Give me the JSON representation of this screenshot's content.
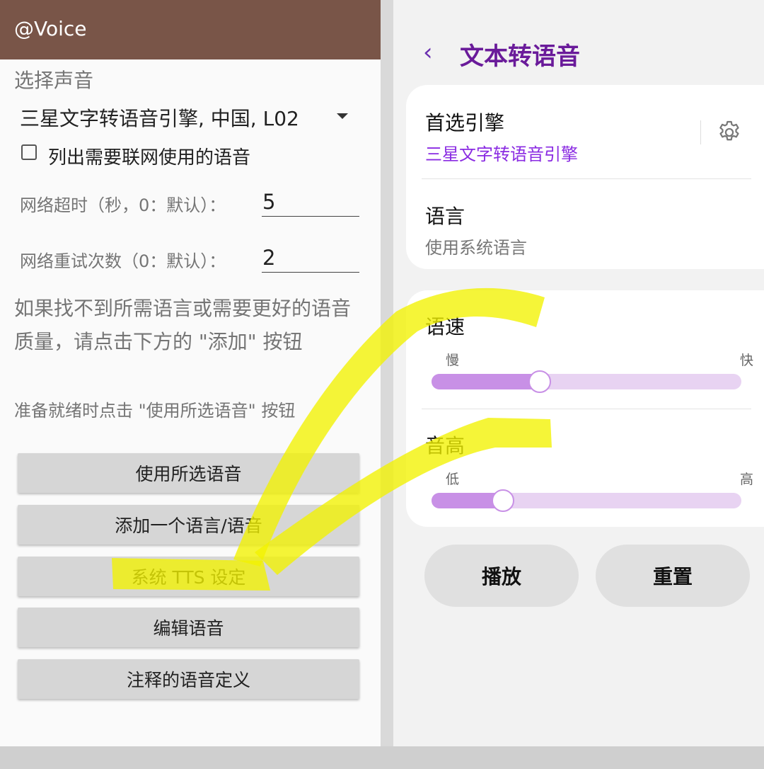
{
  "left_app": {
    "title": "@Voice",
    "select_voice_label": "选择声音",
    "voice_dropdown_value": "三星文字转语音引擎, 中国, L02",
    "network_voices_checkbox_label": "列出需要联网使用的语音",
    "network_timeout": {
      "label": "网络超时（秒，0：默认）：",
      "value": "5"
    },
    "network_retries": {
      "label": "网络重试次数（0：默认）：",
      "value": "2"
    },
    "help_text": "如果找不到所需语言或需要更好的语音质量，请点击下方的 \"添加\" 按钮",
    "ready_text": "准备就绪时点击 \"使用所选语音\" 按钮",
    "buttons": [
      "使用所选语音",
      "添加一个语言/语音",
      "系统 TTS 设定",
      "编辑语音",
      "注释的语音定义"
    ]
  },
  "right_settings": {
    "back_icon": "chevron-left-icon",
    "title": "文本转语音",
    "preferred_engine": {
      "label": "首选引擎",
      "value": "三星文字转语音引擎"
    },
    "language": {
      "label": "语言",
      "value": "使用系统语言"
    },
    "speech_rate": {
      "label": "语速",
      "min_label": "慢",
      "max_label": "快",
      "level": 0.35
    },
    "pitch": {
      "label": "音高",
      "min_label": "低",
      "max_label": "高",
      "level": 0.23
    },
    "play_button": "播放",
    "reset_button": "重置"
  },
  "colors": {
    "appbar": "#795548",
    "accent_purple": "#6a1b9a",
    "slider_fill": "#c890e6",
    "slider_track": "#e8d3f2",
    "highlight": "#f2f200"
  }
}
